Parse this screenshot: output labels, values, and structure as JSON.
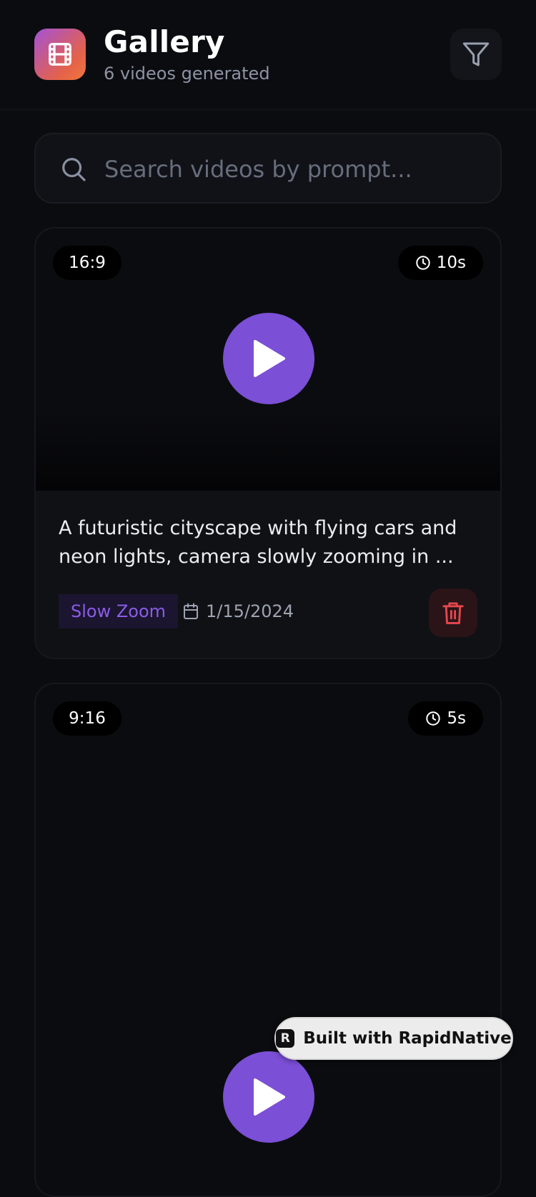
{
  "header": {
    "title": "Gallery",
    "subtitle": "6 videos generated",
    "logo_icon": "film-icon",
    "filter_icon": "filter-icon"
  },
  "search": {
    "placeholder": "Search videos by prompt...",
    "value": "",
    "icon": "search-icon"
  },
  "videos": [
    {
      "aspect_ratio": "16:9",
      "duration": "10s",
      "prompt": "A futuristic cityscape with flying cars and neon lights, camera slowly zooming in ...",
      "camera_style": "Slow Zoom",
      "date": "1/15/2024"
    },
    {
      "aspect_ratio": "9:16",
      "duration": "5s"
    }
  ],
  "badge": {
    "text": "Built with RapidNative",
    "logo_letter": "R"
  },
  "colors": {
    "background": "#0b0c10",
    "accent": "#7b4fd6",
    "danger": "#e5484d",
    "logo_gradient_start": "#a452d6",
    "logo_gradient_end": "#f0763a"
  }
}
